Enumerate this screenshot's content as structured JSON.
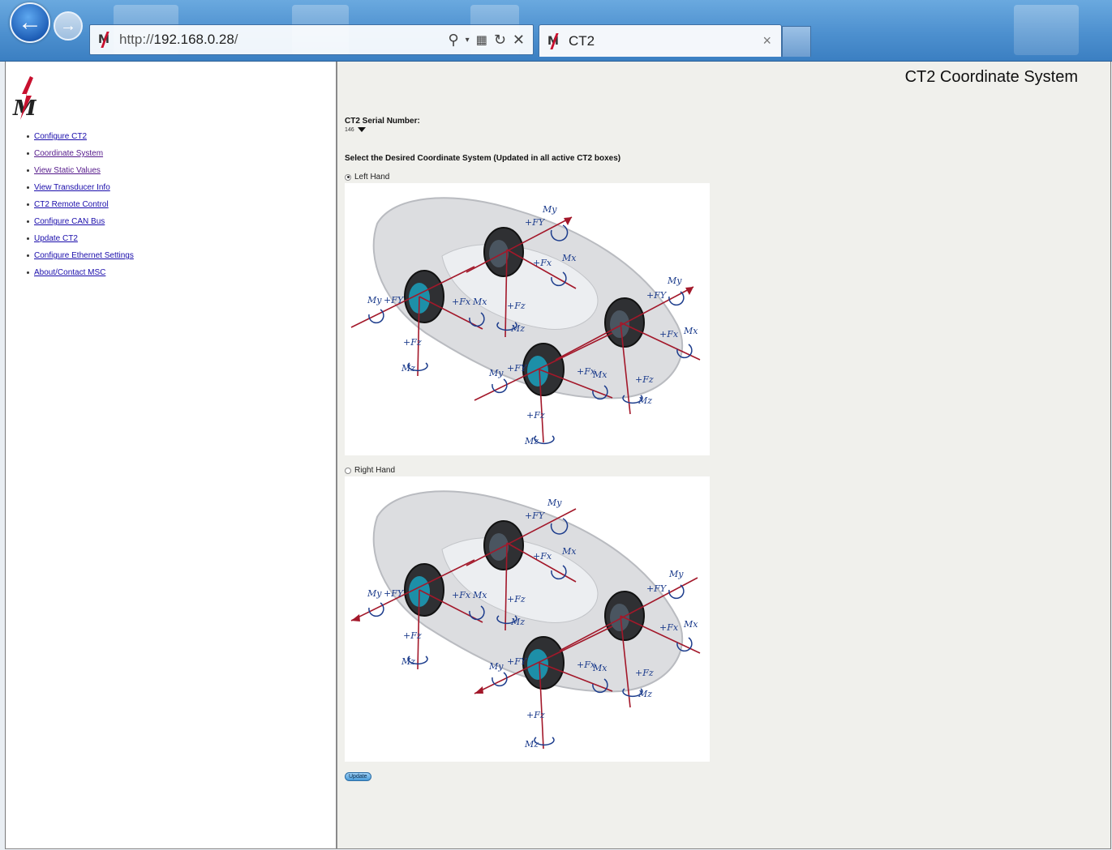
{
  "browser": {
    "url_prefix": "http://",
    "url_host": "192.168.0.28",
    "url_suffix": "/",
    "tab_title": "CT2",
    "tab_close": "×"
  },
  "sidebar": {
    "items": [
      {
        "label": "Configure CT2",
        "visited": false
      },
      {
        "label": "Coordinate System",
        "visited": true
      },
      {
        "label": "View Static Values",
        "visited": true
      },
      {
        "label": "View Transducer Info",
        "visited": false
      },
      {
        "label": "CT2 Remote Control",
        "visited": false
      },
      {
        "label": "Configure CAN Bus",
        "visited": false
      },
      {
        "label": "Update CT2",
        "visited": false
      },
      {
        "label": "Configure Ethernet Settings",
        "visited": false
      },
      {
        "label": "About/Contact MSC",
        "visited": false
      }
    ]
  },
  "main": {
    "title": "CT2 Coordinate System",
    "serial_label": "CT2 Serial Number:",
    "serial_value": "146",
    "instruction": "Select the Desired Coordinate System (Updated in all active CT2 boxes)",
    "options": [
      {
        "label": "Left Hand",
        "checked": true
      },
      {
        "label": "Right Hand",
        "checked": false
      }
    ],
    "update_label": "Update",
    "diagram_labels": {
      "fx": "+Fx",
      "fy": "+FY",
      "fz": "+Fz",
      "mx": "Mx",
      "my": "My",
      "mz": "Mz"
    }
  },
  "colors": {
    "axis_red": "#a3182a",
    "axis_label_blue": "#1c3c8c",
    "link_blue": "#1a0dab",
    "link_visited": "#551a8b",
    "logo_red": "#c8102e"
  }
}
